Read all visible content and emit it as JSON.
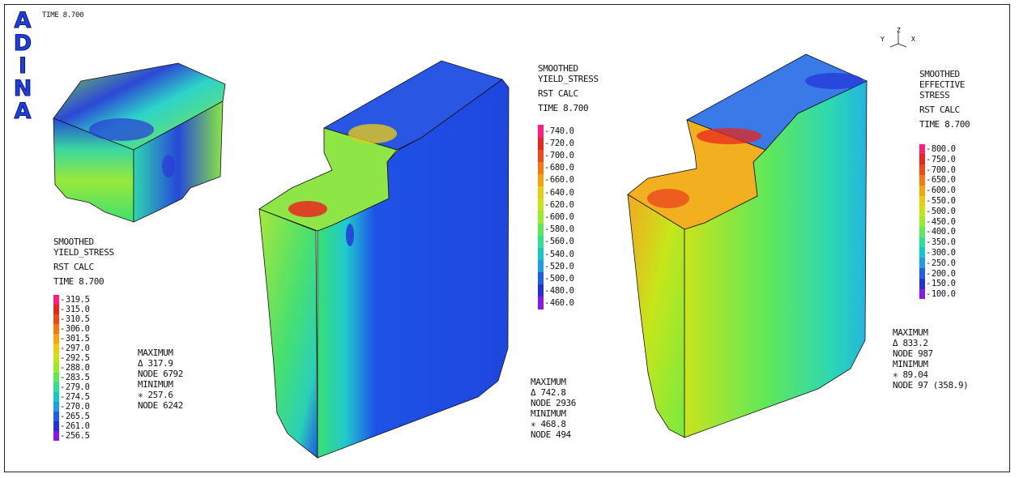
{
  "app": {
    "logo_letters": [
      "A",
      "D",
      "I",
      "N",
      "A"
    ],
    "time_top": "TIME 8.700",
    "axis_labels": {
      "y": "Y",
      "z": "Z",
      "x": "X"
    }
  },
  "panels": [
    {
      "title_1": "SMOOTHED",
      "title_2": "YIELD_STRESS",
      "subtitle": "RST CALC",
      "time": "TIME 8.700",
      "scale": [
        "319.5",
        "315.0",
        "310.5",
        "306.0",
        "301.5",
        "297.0",
        "292.5",
        "288.0",
        "283.5",
        "279.0",
        "274.5",
        "270.0",
        "265.5",
        "261.0",
        "256.5"
      ],
      "max_label": "MAXIMUM",
      "max_value": "Δ 317.9",
      "max_node": "NODE 6792",
      "min_label": "MINIMUM",
      "min_value": "✳ 257.6",
      "min_node": "NODE 6242"
    },
    {
      "title_1": "SMOOTHED",
      "title_2": "YIELD_STRESS",
      "subtitle": "RST CALC",
      "time": "TIME 8.700",
      "scale": [
        "740.0",
        "720.0",
        "700.0",
        "680.0",
        "660.0",
        "640.0",
        "620.0",
        "600.0",
        "580.0",
        "560.0",
        "540.0",
        "520.0",
        "500.0",
        "480.0",
        "460.0"
      ],
      "max_label": "MAXIMUM",
      "max_value": "Δ 742.8",
      "max_node": "NODE 2936",
      "min_label": "MINIMUM",
      "min_value": "✳ 468.8",
      "min_node": "NODE 494"
    },
    {
      "title_1": "SMOOTHED",
      "title_2": "EFFECTIVE",
      "title_3": "STRESS",
      "subtitle": "RST CALC",
      "time": "TIME 8.700",
      "scale": [
        "800.0",
        "750.0",
        "700.0",
        "650.0",
        "600.0",
        "550.0",
        "500.0",
        "450.0",
        "400.0",
        "350.0",
        "300.0",
        "250.0",
        "200.0",
        "150.0",
        "100.0"
      ],
      "max_label": "MAXIMUM",
      "max_value": "Δ 833.2",
      "max_node": "NODE 987",
      "min_label": "MINIMUM",
      "min_value": "✳ 89.04",
      "min_node": "NODE 97 (358.9)"
    }
  ],
  "colors": {
    "band_scale": [
      "#ff1e7a",
      "#e8261e",
      "#f04818",
      "#f6780e",
      "#f7a40c",
      "#e7cc10",
      "#c6e418",
      "#98ec2a",
      "#5ee85a",
      "#2ee092",
      "#14c8c8",
      "#1e9ce6",
      "#1e5ee8",
      "#2232d8",
      "#8a18e8"
    ],
    "logo": "#1f3fd8"
  }
}
